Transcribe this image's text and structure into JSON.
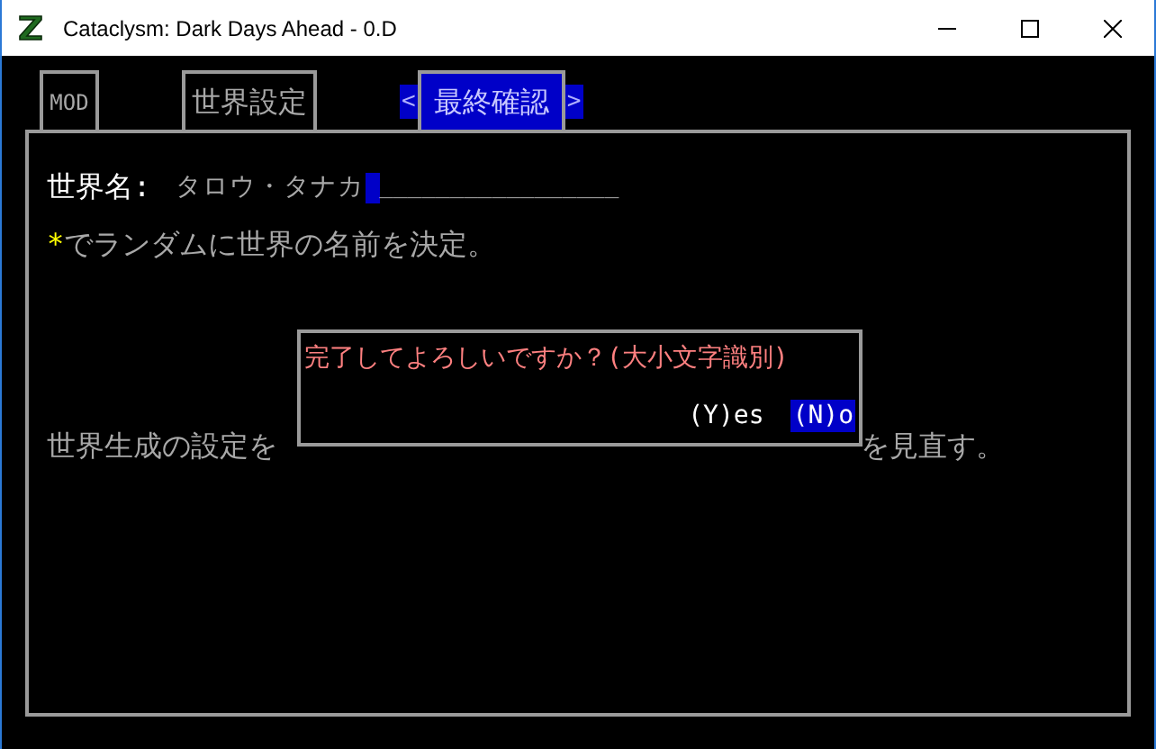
{
  "window": {
    "title": "Cataclysm: Dark Days Ahead - 0.D"
  },
  "tabs": [
    {
      "label": "MOD",
      "selected": false
    },
    {
      "label": "世界設定",
      "selected": false
    },
    {
      "label": "最終確認",
      "selected": true
    }
  ],
  "tab_arrows": {
    "left": "<",
    "right": ">"
  },
  "world_name": {
    "label": "世界名:",
    "value": "タロウ・タナカ",
    "fill": "_________________"
  },
  "random_hint": {
    "key": "*",
    "text": "でランダムに世界の名前を決定。"
  },
  "background_line": {
    "left": "世界生成の設定を",
    "right": "を見直す。"
  },
  "dialog": {
    "message": "完了してよろしいですか？(大小文字識別)",
    "buttons": [
      {
        "label": "(Y)es",
        "selected": false
      },
      {
        "label": "(N)o",
        "selected": true
      }
    ]
  }
}
